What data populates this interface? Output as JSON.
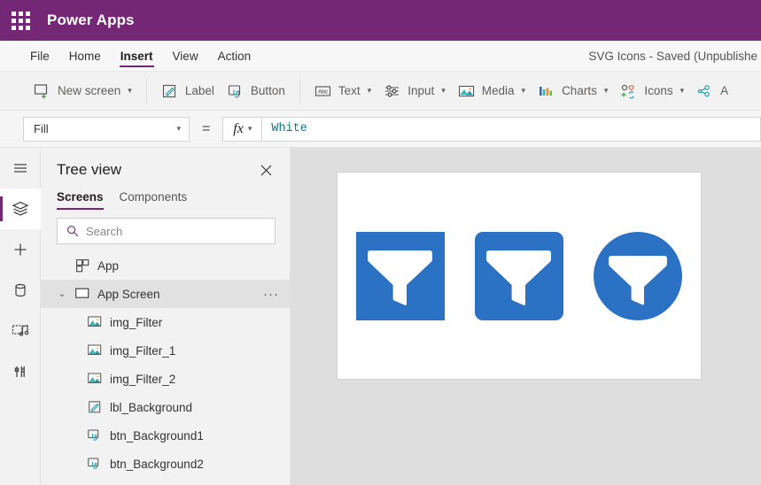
{
  "titlebar": {
    "waffle_icon": "app-launcher-grid-icon",
    "brand": "Power Apps",
    "background": "#742774"
  },
  "menubar": {
    "items": [
      {
        "label": "File",
        "active": false
      },
      {
        "label": "Home",
        "active": false
      },
      {
        "label": "Insert",
        "active": true
      },
      {
        "label": "View",
        "active": false
      },
      {
        "label": "Action",
        "active": false
      }
    ],
    "document_title": "SVG Icons - Saved (Unpublishe"
  },
  "ribbon": {
    "items": [
      {
        "label": "New screen",
        "icon": "new-screen-icon",
        "has_chevron": true
      },
      {
        "label": "Label",
        "icon": "label-pencil-icon",
        "has_chevron": false
      },
      {
        "label": "Button",
        "icon": "button-cursor-icon",
        "has_chevron": false
      },
      {
        "label": "Text",
        "icon": "text-abc-icon",
        "has_chevron": true
      },
      {
        "label": "Input",
        "icon": "input-sliders-icon",
        "has_chevron": true
      },
      {
        "label": "Media",
        "icon": "media-image-icon",
        "has_chevron": true
      },
      {
        "label": "Charts",
        "icon": "charts-bar-icon",
        "has_chevron": true
      },
      {
        "label": "Icons",
        "icon": "icons-shapes-icon",
        "has_chevron": true
      },
      {
        "label": "A",
        "icon": "ai-connector-icon",
        "has_chevron": false
      }
    ]
  },
  "formulabar": {
    "property": "Fill",
    "equals": "=",
    "fx_label": "fx",
    "formula_value": "White",
    "chevron_icon": "chevron-down-icon"
  },
  "rail": {
    "items": [
      {
        "name": "menu-hamburger",
        "icon": "hamburger-icon",
        "active": false
      },
      {
        "name": "tree-view",
        "icon": "layers-icon",
        "active": true
      },
      {
        "name": "insert",
        "icon": "plus-icon",
        "active": false
      },
      {
        "name": "data",
        "icon": "database-icon",
        "active": false
      },
      {
        "name": "media",
        "icon": "media-library-icon",
        "active": false
      },
      {
        "name": "advanced",
        "icon": "tools-icon",
        "active": false
      }
    ]
  },
  "treeview": {
    "title": "Tree view",
    "close_icon": "close-icon",
    "tabs": [
      {
        "label": "Screens",
        "active": true
      },
      {
        "label": "Components",
        "active": false
      }
    ],
    "search": {
      "placeholder": "Search",
      "value": "",
      "icon": "search-icon"
    },
    "nodes": [
      {
        "label": "App",
        "icon": "app-icon",
        "level": 1,
        "selected": false,
        "chevron": "",
        "more": ""
      },
      {
        "label": "App Screen",
        "icon": "screen-icon",
        "level": 1,
        "selected": true,
        "chevron": "⌄",
        "more": "···"
      },
      {
        "label": "img_Filter",
        "icon": "image-icon",
        "level": 2,
        "selected": false,
        "chevron": "",
        "more": ""
      },
      {
        "label": "img_Filter_1",
        "icon": "image-icon",
        "level": 2,
        "selected": false,
        "chevron": "",
        "more": ""
      },
      {
        "label": "img_Filter_2",
        "icon": "image-icon",
        "level": 2,
        "selected": false,
        "chevron": "",
        "more": ""
      },
      {
        "label": "lbl_Background",
        "icon": "label-icon",
        "level": 2,
        "selected": false,
        "chevron": "",
        "more": ""
      },
      {
        "label": "btn_Background1",
        "icon": "button-icon",
        "level": 2,
        "selected": false,
        "chevron": "",
        "more": ""
      },
      {
        "label": "btn_Background2",
        "icon": "button-icon",
        "level": 2,
        "selected": false,
        "chevron": "",
        "more": ""
      }
    ]
  },
  "canvas": {
    "background": "#ffffff",
    "surround": "#dedede",
    "icon_color": "#2b72c4",
    "shapes": [
      {
        "name": "img_Filter",
        "shape": "square",
        "glyph": "funnel-filter-icon"
      },
      {
        "name": "img_Filter_1",
        "shape": "rounded-square",
        "glyph": "funnel-filter-icon"
      },
      {
        "name": "img_Filter_2",
        "shape": "circle",
        "glyph": "funnel-filter-icon"
      }
    ]
  }
}
